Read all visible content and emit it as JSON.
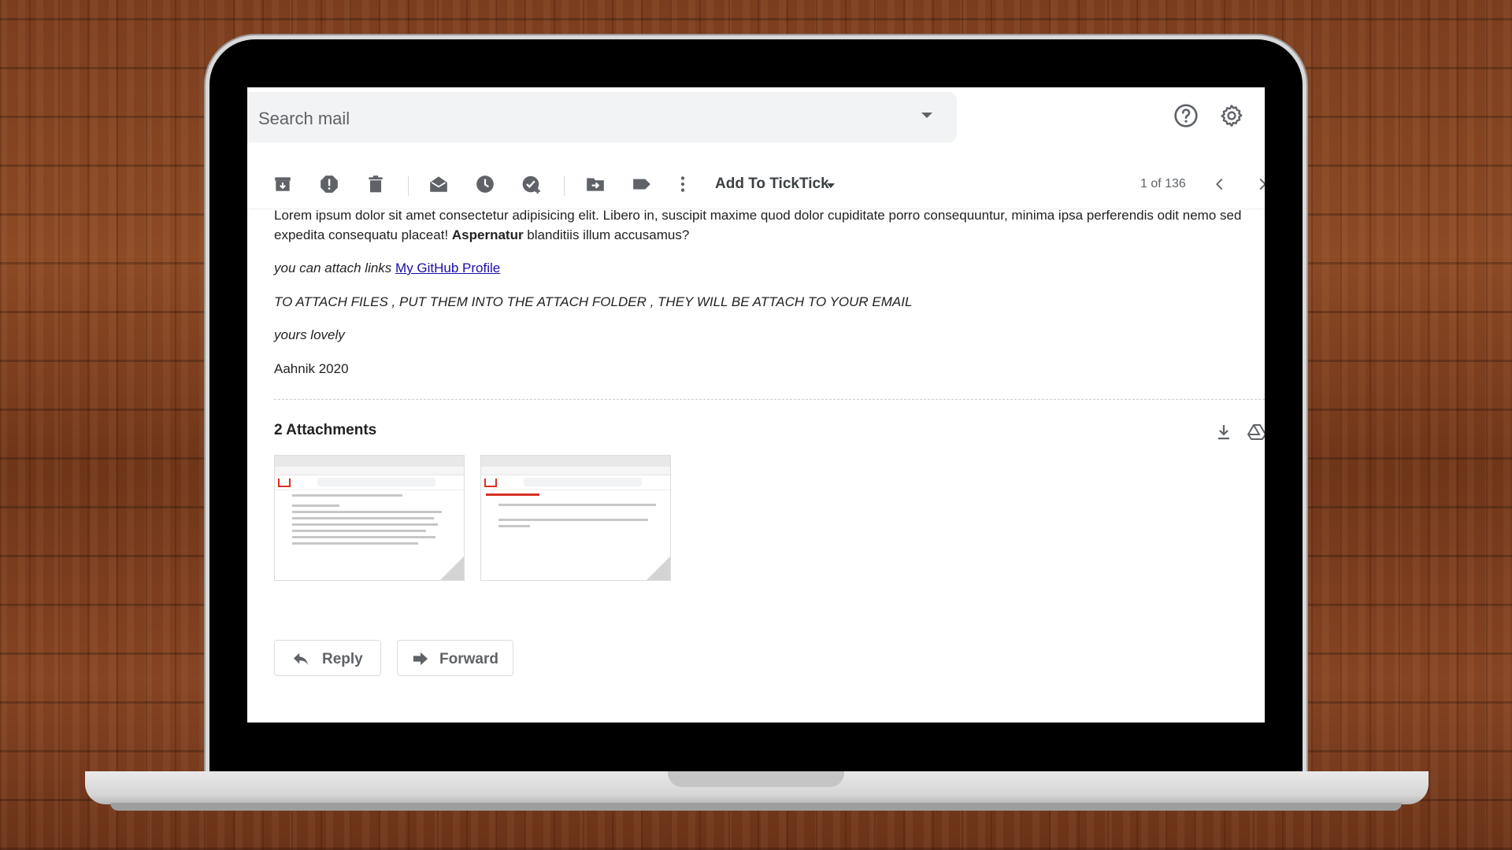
{
  "search": {
    "placeholder": "Search mail"
  },
  "toolbar": {
    "add_to_ticktick": "Add To TickTick",
    "pager": "1 of 136"
  },
  "message": {
    "body_pre": "Lorem ipsum dolor sit amet consectetur adipisicing elit. Libero in, suscipit maxime quod dolor cupiditate porro consequuntur, minima ipsa perferendis odit nemo sed expedita consequatu placeat! ",
    "body_bold": "Aspernatur",
    "body_post": " blanditiis illum accusamus?",
    "links_prefix": "you can attach links ",
    "link_text": "My GitHub Profile",
    "files_line": "TO ATTACH FILES , PUT THEM INTO THE ATTACH FOLDER , THEY WILL BE ATTACH TO YOUR EMAIL",
    "yours_line": "yours lovely",
    "signature": "Aahnik 2020"
  },
  "attachments": {
    "title": "2 Attachments",
    "count": 2
  },
  "actions": {
    "reply_label": "Reply",
    "forward_label": "Forward"
  },
  "colors": {
    "accent_red": "#d93025",
    "link_blue": "#1a0dab",
    "icon_grey": "#5f6368"
  }
}
